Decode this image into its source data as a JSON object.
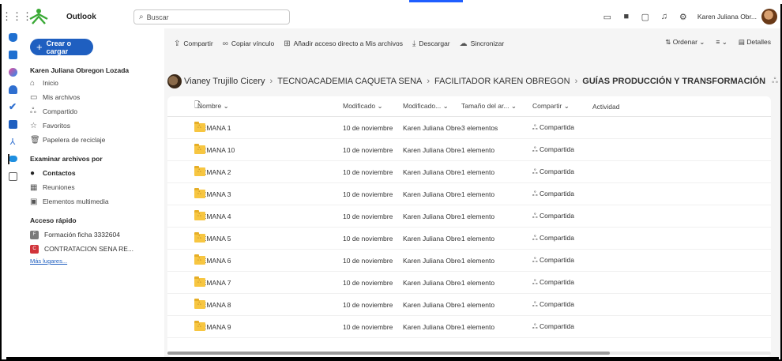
{
  "header": {
    "app_name": "Outlook",
    "search_placeholder": "Buscar",
    "user_name": "Karen Juliana Obr..."
  },
  "sidebar": {
    "create_label": "Crear o cargar",
    "owner": "Karen Juliana Obregon Lozada",
    "nav": [
      {
        "label": "Inicio",
        "icon": "home-icon"
      },
      {
        "label": "Mis archivos",
        "icon": "folder-icon"
      },
      {
        "label": "Compartido",
        "icon": "people-icon"
      },
      {
        "label": "Favoritos",
        "icon": "star-icon"
      },
      {
        "label": "Papelera de reciclaje",
        "icon": "trash-icon"
      }
    ],
    "browse_heading": "Examinar archivos por",
    "browse": [
      {
        "label": "Contactos",
        "icon": "person-icon"
      },
      {
        "label": "Reuniones",
        "icon": "calendar-icon"
      },
      {
        "label": "Elementos multimedia",
        "icon": "image-icon"
      }
    ],
    "quick_heading": "Acceso rápido",
    "quick": [
      {
        "label": "Formación ficha 3332604",
        "color": "#7a7a7a"
      },
      {
        "label": "CONTRATACION SENA RE...",
        "color": "#d1343b"
      }
    ],
    "more_places": "Más lugares..."
  },
  "commandbar": {
    "share": "Compartir",
    "copy_link": "Copiar vínculo",
    "add_shortcut": "Añadir acceso directo a Mis archivos",
    "download": "Descargar",
    "sync": "Sincronizar",
    "sort": "Ordenar",
    "details": "Detalles"
  },
  "breadcrumb": {
    "items": [
      "Vianey Trujillo Cicery",
      "TECNOACADEMIA CAQUETA SENA",
      "FACILITADOR KAREN OBREGON"
    ],
    "current": "GUÍAS PRODUCCIÓN Y TRANSFORMACIÓN"
  },
  "table": {
    "columns": {
      "name": "Nombre",
      "modified": "Modificado",
      "modified_by": "Modificado...",
      "size": "Tamaño del ar...",
      "sharing": "Compartir",
      "activity": "Actividad"
    },
    "rows": [
      {
        "name": "SEMANA 1",
        "modified": "10 de noviembre",
        "modified_by": "Karen Juliana Obreg",
        "size": "3 elementos",
        "sharing": "Compartida"
      },
      {
        "name": "SEMANA 10",
        "modified": "10 de noviembre",
        "modified_by": "Karen Juliana Obreg",
        "size": "1 elemento",
        "sharing": "Compartida"
      },
      {
        "name": "SEMANA 2",
        "modified": "10 de noviembre",
        "modified_by": "Karen Juliana Obreg",
        "size": "1 elemento",
        "sharing": "Compartida"
      },
      {
        "name": "SEMANA 3",
        "modified": "10 de noviembre",
        "modified_by": "Karen Juliana Obreg",
        "size": "1 elemento",
        "sharing": "Compartida"
      },
      {
        "name": "SEMANA 4",
        "modified": "10 de noviembre",
        "modified_by": "Karen Juliana Obreg",
        "size": "1 elemento",
        "sharing": "Compartida"
      },
      {
        "name": "SEMANA 5",
        "modified": "10 de noviembre",
        "modified_by": "Karen Juliana Obreg",
        "size": "1 elemento",
        "sharing": "Compartida"
      },
      {
        "name": "SEMANA 6",
        "modified": "10 de noviembre",
        "modified_by": "Karen Juliana Obreg",
        "size": "1 elemento",
        "sharing": "Compartida"
      },
      {
        "name": "SEMANA 7",
        "modified": "10 de noviembre",
        "modified_by": "Karen Juliana Obreg",
        "size": "1 elemento",
        "sharing": "Compartida"
      },
      {
        "name": "SEMANA 8",
        "modified": "10 de noviembre",
        "modified_by": "Karen Juliana Obreg",
        "size": "1 elemento",
        "sharing": "Compartida"
      },
      {
        "name": "SEMANA 9",
        "modified": "10 de noviembre",
        "modified_by": "Karen Juliana Obreg",
        "size": "1 elemento",
        "sharing": "Compartida"
      }
    ]
  },
  "colors": {
    "accent": "#1f5fc0",
    "folder": "#f7c641"
  }
}
